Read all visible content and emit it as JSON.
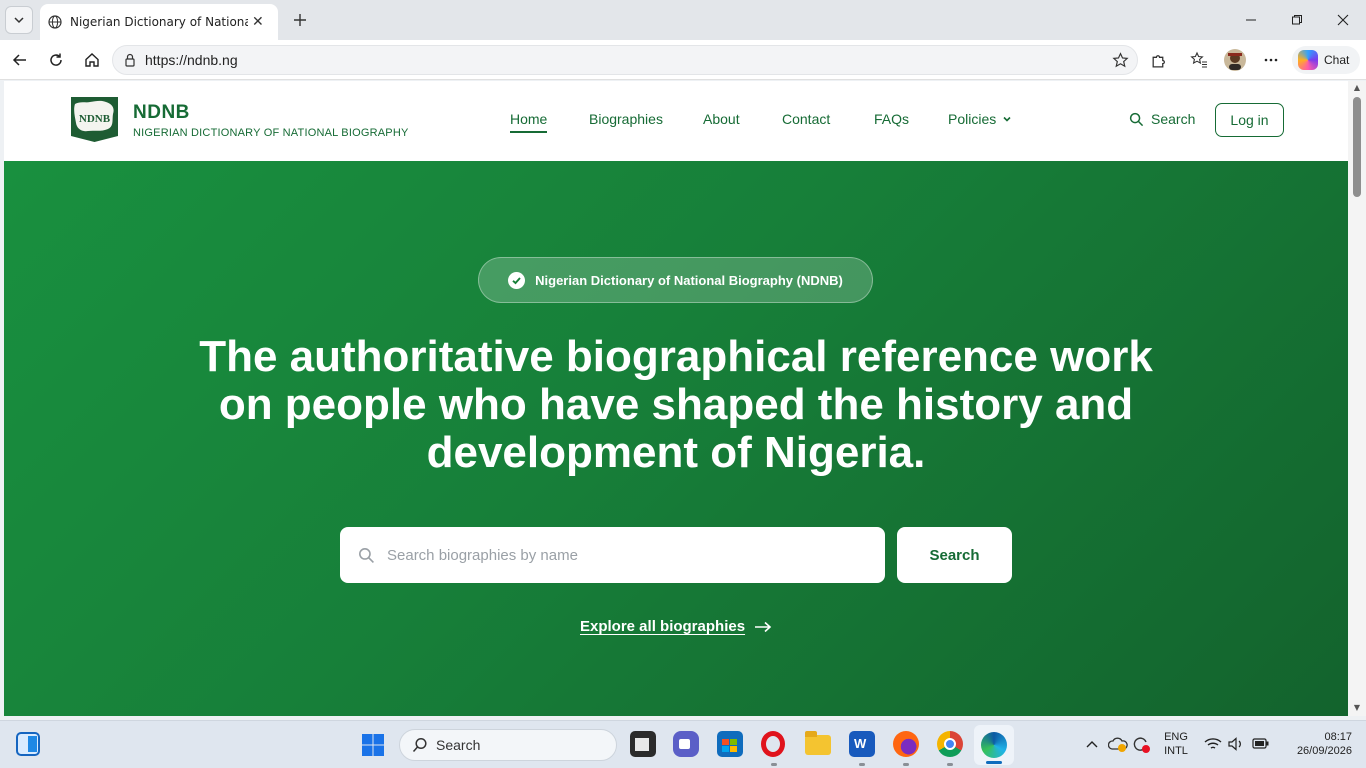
{
  "browser": {
    "tab_title": "Nigerian Dictionary of National Biography",
    "url": "https://ndnb.ng",
    "chat_label": "Chat"
  },
  "site": {
    "brand_name": "NDNB",
    "brand_subtitle": "NIGERIAN DICTIONARY OF NATIONAL BIOGRAPHY",
    "logo_text": "NDNB",
    "nav": {
      "home": "Home",
      "biographies": "Biographies",
      "about": "About",
      "contact": "Contact",
      "faqs": "FAQs",
      "policies": "Policies"
    },
    "search_label": "Search",
    "login_label": "Log in"
  },
  "hero": {
    "badge": "Nigerian Dictionary of National Biography (NDNB)",
    "title_line1": "The authoritative biographical reference work",
    "title_line2": "on people who have shaped the history and",
    "title_line3": "development of Nigeria.",
    "search_placeholder": "Search biographies by name",
    "search_button": "Search",
    "explore_link": "Explore all biographies"
  },
  "taskbar": {
    "search_label": "Search",
    "lang_line1": "ENG",
    "lang_line2": "INTL",
    "time": "08:17",
    "date": "26/09/2026"
  },
  "colors": {
    "brand_green": "#166b35",
    "hero_green": "#177f39"
  }
}
